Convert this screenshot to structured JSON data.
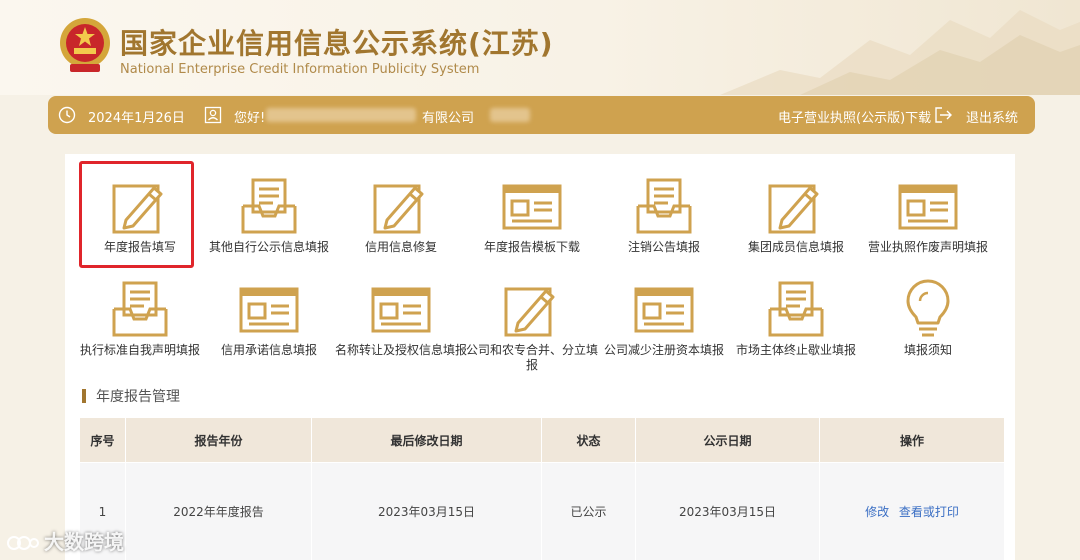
{
  "header": {
    "title": "国家企业信用信息公示系统(江苏)",
    "subtitle": "National Enterprise Credit Information Publicity System"
  },
  "userbar": {
    "date": "2024年1月26日",
    "greeting": "您好!",
    "company_suffix": "有限公司",
    "license_link": "电子营业执照(公示版)下载",
    "logout": "退出系统"
  },
  "functions": [
    {
      "label": "年度报告填写",
      "icon": "pencil-form-icon",
      "selected": true
    },
    {
      "label": "其他自行公示信息填报",
      "icon": "inbox-document-icon"
    },
    {
      "label": "信用信息修复",
      "icon": "pencil-form-icon"
    },
    {
      "label": "年度报告模板下载",
      "icon": "template-window-icon"
    },
    {
      "label": "注销公告填报",
      "icon": "inbox-document-icon"
    },
    {
      "label": "集团成员信息填报",
      "icon": "pencil-form-icon"
    },
    {
      "label": "营业执照作废声明填报",
      "icon": "template-window-icon"
    },
    {
      "label": "执行标准自我声明填报",
      "icon": "inbox-document-icon"
    },
    {
      "label": "信用承诺信息填报",
      "icon": "template-window-icon"
    },
    {
      "label": "名称转让及授权信息填报",
      "icon": "template-window-icon"
    },
    {
      "label": "公司和农专合并、分立填报",
      "icon": "pencil-form-icon"
    },
    {
      "label": "公司减少注册资本填报",
      "icon": "template-window-icon"
    },
    {
      "label": "市场主体终止歇业填报",
      "icon": "inbox-document-icon"
    },
    {
      "label": "填报须知",
      "icon": "lightbulb-icon"
    }
  ],
  "section": {
    "title": "年度报告管理"
  },
  "table": {
    "headers": [
      "序号",
      "报告年份",
      "最后修改日期",
      "状态",
      "公示日期",
      "操作"
    ],
    "rows": [
      {
        "no": "1",
        "year": "2022年年度报告",
        "modified": "2023年03月15日",
        "status": "已公示",
        "published": "2023年03月15日",
        "action_edit": "修改",
        "action_view": "查看或打印"
      }
    ]
  },
  "watermark": {
    "text": "大数跨境"
  },
  "colors": {
    "gold": "#cfa24f",
    "title_gold": "#a1762f",
    "highlight": "#e0252b",
    "link_blue": "#3b6fc4"
  }
}
